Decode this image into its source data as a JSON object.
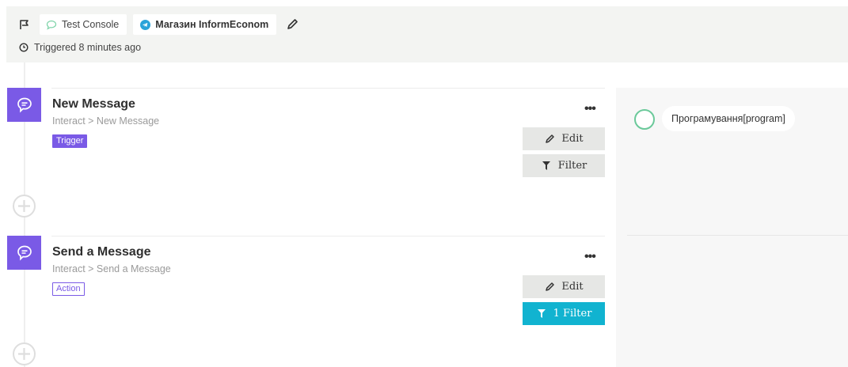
{
  "header": {
    "console_label": "Test Console",
    "channel_label": "Магазин InformEconom",
    "triggered_text": "Triggered 8 minutes ago"
  },
  "steps": [
    {
      "title": "New Message",
      "breadcrumb": "Interact > New Message",
      "tag": "Trigger",
      "more_label": "•••",
      "edit_label": "Edit",
      "filter_label": "Filter"
    },
    {
      "title": "Send a Message",
      "breadcrumb": "Interact > Send a Message",
      "tag": "Action",
      "more_label": "•••",
      "edit_label": "Edit",
      "filter_label": "1 Filter"
    }
  ],
  "right_panel": {
    "variable_label": "Програмування[program]"
  },
  "colors": {
    "accent_purple": "#7a5ae6",
    "filter_active": "#11b3d0",
    "status_green": "#6bc99a",
    "telegram_blue": "#2aa3d9"
  },
  "icons": {
    "flag": "flag-icon",
    "console": "speech-bubble-icon",
    "channel": "telegram-icon",
    "edit_title": "pencil-icon",
    "clock": "clock-icon",
    "step": "chat-bubble-icon",
    "add": "plus-circle-icon",
    "filter": "funnel-icon"
  }
}
